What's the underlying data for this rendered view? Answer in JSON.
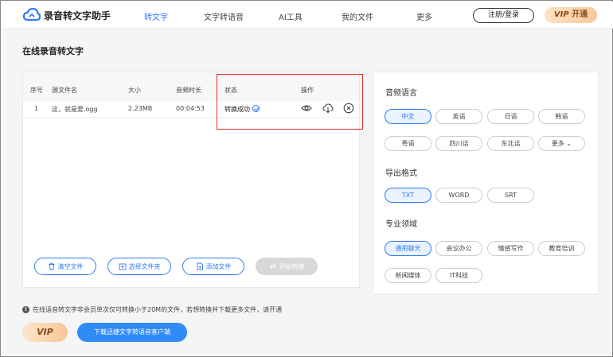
{
  "header": {
    "app_title": "录音转文字助手",
    "nav": [
      "转文字",
      "文字转语音",
      "AI工具",
      "我的文件",
      "更多"
    ],
    "login_label": "注册/登录",
    "vip_prefix": "VIP",
    "vip_label": "开通"
  },
  "main": {
    "page_title": "在线录音转文字",
    "table": {
      "columns": [
        "序号",
        "源文件名",
        "大小",
        "音频时长",
        "状态",
        "操作"
      ],
      "rows": [
        {
          "index": "1",
          "name": "这，就是爱.ogg",
          "size": "2.23MB",
          "duration": "00:04:53",
          "status": "转换成功"
        }
      ]
    },
    "buttons": {
      "clear": "清空文件",
      "select_folder": "选择文件夹",
      "add_file": "添加文件",
      "start": "开始转换"
    }
  },
  "options": {
    "audio_language_title": "音频语言",
    "languages": [
      "中文",
      "英语",
      "日语",
      "韩语",
      "粤语",
      "四川话",
      "东北话",
      "更多"
    ],
    "selected_language": "中文",
    "export_format_title": "导出格式",
    "formats": [
      "TXT",
      "WORD",
      "SRT"
    ],
    "selected_format": "TXT",
    "domain_title": "专业领域",
    "domains": [
      "通用聊天",
      "会议办公",
      "情感写作",
      "教育培训",
      "新闻媒体",
      "IT科技"
    ],
    "selected_domain": "通用聊天"
  },
  "footer": {
    "notice": "在线语音转文字非会员单次仅可转换小于20M的文件，若想转换并下载更多文件，请开通",
    "vip_label": "VIP",
    "download_label": "下载迅捷文字转语音客户端"
  },
  "colors": {
    "accent": "#2f7bf6",
    "highlight_box": "#d9302a",
    "vip": "#f9c89b"
  }
}
